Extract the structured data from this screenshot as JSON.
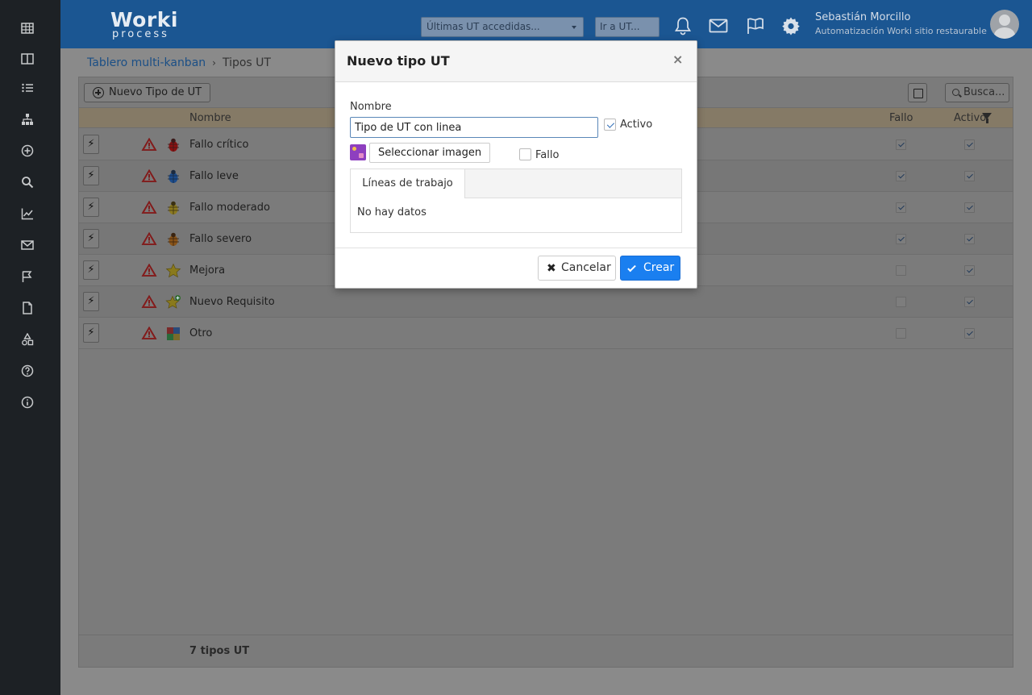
{
  "header": {
    "logo_line1": "Worki",
    "logo_line2": "process",
    "recent_placeholder": "Últimas UT accedidas...",
    "goto_placeholder": "Ir a UT...",
    "user_name": "Sebastián Morcillo",
    "user_org": "Automatización Worki sitio restaurable"
  },
  "breadcrumb": {
    "parent": "Tablero multi-kanban",
    "separator": "›",
    "current": "Tipos UT"
  },
  "toolbar": {
    "new_button": "Nuevo Tipo de UT",
    "search_placeholder": "Busca..."
  },
  "table": {
    "col_name": "Nombre",
    "col_fallo": "Fallo",
    "col_activo": "Activo",
    "rows": [
      {
        "name": "Fallo crítico",
        "icon": "bug-red-icon",
        "fallo": true,
        "activo": true
      },
      {
        "name": "Fallo leve",
        "icon": "bug-blue-icon",
        "fallo": true,
        "activo": true
      },
      {
        "name": "Fallo moderado",
        "icon": "bug-yellow-icon",
        "fallo": true,
        "activo": true
      },
      {
        "name": "Fallo severo",
        "icon": "bug-orange-icon",
        "fallo": true,
        "activo": true
      },
      {
        "name": "Mejora",
        "icon": "star-icon",
        "fallo": false,
        "activo": true
      },
      {
        "name": "Nuevo Requisito",
        "icon": "star-plus-icon",
        "fallo": false,
        "activo": true
      },
      {
        "name": "Otro",
        "icon": "puzzle-icon",
        "fallo": false,
        "activo": true
      }
    ],
    "footer": "7 tipos UT"
  },
  "modal": {
    "title": "Nuevo tipo UT",
    "close": "×",
    "name_label": "Nombre",
    "name_value": "Tipo de UT con linea",
    "activo_label": "Activo",
    "activo_checked": true,
    "select_image": "Seleccionar imagen",
    "fallo_label": "Fallo",
    "fallo_checked": false,
    "tab_label": "Líneas de trabajo",
    "no_data": "No hay datos",
    "cancel": "Cancelar",
    "create": "Crear"
  },
  "colors": {
    "header_bg": "#1b5692",
    "sidebar_bg": "#1d2125",
    "primary_button": "#1a7ff0"
  }
}
